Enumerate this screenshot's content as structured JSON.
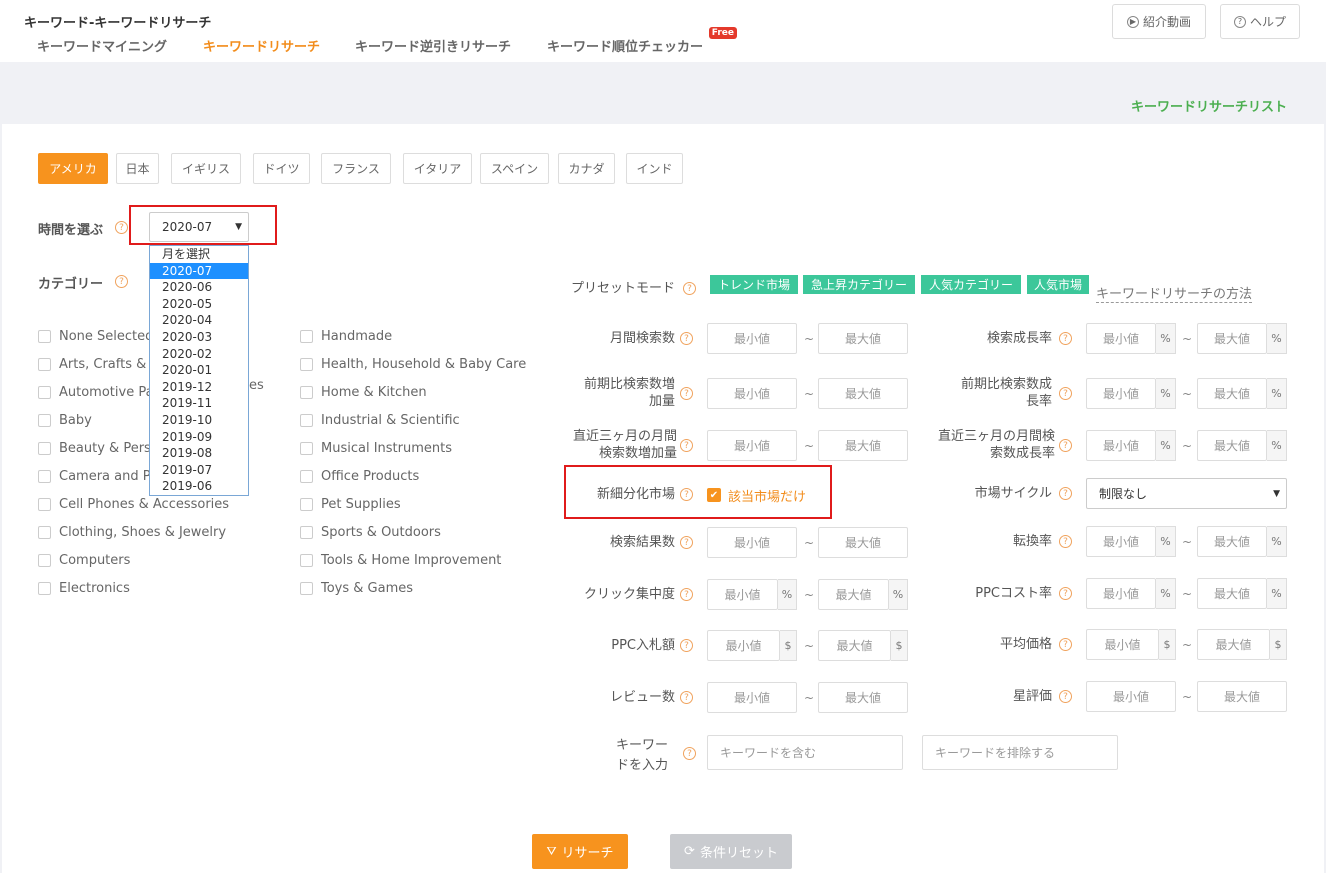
{
  "header": {
    "title": "キーワード-キーワードリサーチ",
    "intro_video_label": "紹介動画",
    "help_label": "ヘルプ"
  },
  "tabs": [
    {
      "label": "キーワードマイニング"
    },
    {
      "label": "キーワードリサーチ"
    },
    {
      "label": "キーワード逆引きリサーチ"
    },
    {
      "label": "キーワード順位チェッカー",
      "badge": "Free"
    }
  ],
  "research_list_link": "キーワードリサーチリスト",
  "countries": [
    "アメリカ",
    "日本",
    "イギリス",
    "ドイツ",
    "フランス",
    "イタリア",
    "スペイン",
    "カナダ",
    "インド"
  ],
  "time": {
    "label": "時間を選ぶ",
    "selected": "2020-07",
    "options": [
      "月を選択",
      "2020-07",
      "2020-06",
      "2020-05",
      "2020-04",
      "2020-03",
      "2020-02",
      "2020-01",
      "2019-12",
      "2019-11",
      "2019-10",
      "2019-09",
      "2019-08",
      "2019-07",
      "2019-06"
    ]
  },
  "category": {
    "label": "カテゴリー",
    "left": [
      "None Selected",
      "Arts, Crafts &",
      "Automotive Pa",
      "Baby",
      "Beauty & Perso",
      "Camera and P",
      "Cell Phones & Accessories",
      "Clothing, Shoes & Jewelry",
      "Computers",
      "Electronics"
    ],
    "left_peek": [
      "",
      "",
      "es",
      "",
      "",
      "",
      "",
      "",
      "",
      ""
    ],
    "right": [
      "Handmade",
      "Health, Household & Baby Care",
      "Home & Kitchen",
      "Industrial & Scientific",
      "Musical Instruments",
      "Office Products",
      "Pet Supplies",
      "Sports & Outdoors",
      "Tools & Home Improvement",
      "Toys & Games"
    ]
  },
  "preset": {
    "label": "プリセットモード",
    "tags": [
      "トレンド市場",
      "急上昇カテゴリー",
      "人気カテゴリー",
      "人気市場"
    ],
    "method_link": "キーワードリサーチの方法"
  },
  "filters": {
    "min": "最小値",
    "max": "最大値",
    "monthly_search": "月間検索数",
    "search_growth": "検索成長率",
    "prev_increase": "前期比検索数増加量",
    "prev_growth": "前期比検索数成長率",
    "three_month_increase": "直近三ヶ月の月間検索数増加量",
    "three_month_growth": "直近三ヶ月の月間検索数成長率",
    "new_market": "新細分化市場",
    "new_market_check": "該当市場だけ",
    "market_cycle": "市場サイクル",
    "market_cycle_value": "制限なし",
    "results": "検索結果数",
    "conversion": "転換率",
    "click_concentration": "クリック集中度",
    "ppc_cost": "PPCコスト率",
    "ppc_bid": "PPC入札額",
    "avg_price": "平均価格",
    "reviews": "レビュー数",
    "rating": "星評価",
    "keyword_input": "キーワードを入力",
    "include_placeholder": "キーワードを含む",
    "exclude_placeholder": "キーワードを排除する",
    "unit_percent": "%",
    "unit_dollar": "$",
    "tilde": "~"
  },
  "actions": {
    "research": "リサーチ",
    "reset": "条件リセット"
  },
  "colors": {
    "accent": "#f7931e",
    "tag_green": "#3cc79a",
    "link_green": "#4caf50",
    "highlight_red": "#e01b1b",
    "selected_blue": "#1e90ff"
  }
}
